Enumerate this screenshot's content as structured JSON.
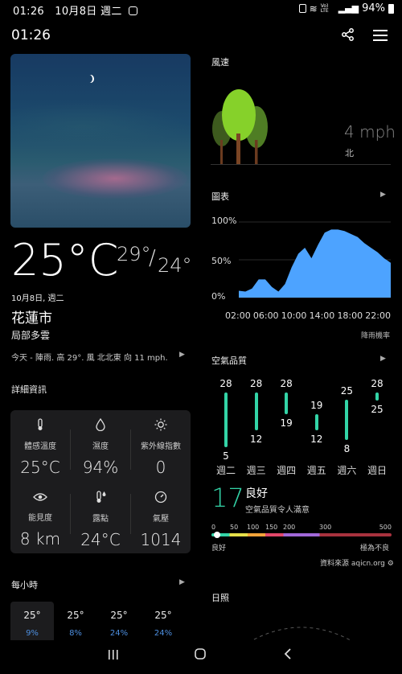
{
  "status_bar": {
    "time": "01:26",
    "date": "10月8日 週二",
    "battery": "94%",
    "volte": "Vo) LTE"
  },
  "header": {
    "time": "01:26"
  },
  "current": {
    "temp": "25°C",
    "high": "29°",
    "sep": "/",
    "low": "24°",
    "date": "10月8日, 週二",
    "city": "花蓮市",
    "condition": "局部多雲",
    "summary": "今天 - 陣雨. 高 29°. 風 北北東 向 11 mph."
  },
  "details": {
    "title": "詳細資訊",
    "cells": [
      {
        "label": "體感溫度",
        "value": "25°C",
        "icon": "thermometer-icon"
      },
      {
        "label": "濕度",
        "value": "94%",
        "icon": "droplet-icon"
      },
      {
        "label": "紫外線指數",
        "value": "0",
        "icon": "sun-icon"
      },
      {
        "label": "能見度",
        "value": "8 km",
        "icon": "eye-icon"
      },
      {
        "label": "露點",
        "value": "24°C",
        "icon": "dewpoint-icon"
      },
      {
        "label": "氣壓",
        "value": "1014",
        "icon": "gauge-icon"
      }
    ]
  },
  "hourly": {
    "title": "每小時",
    "items": [
      {
        "temp": "25°",
        "precip": "9%"
      },
      {
        "temp": "25°",
        "precip": "8%"
      },
      {
        "temp": "25°",
        "precip": "24%"
      },
      {
        "temp": "25°",
        "precip": "24%"
      }
    ]
  },
  "wind": {
    "title": "風速",
    "speed": "4 mph",
    "direction": "北"
  },
  "chart": {
    "title": "圖表",
    "footer": "降雨機率",
    "y_ticks": [
      "100%",
      "50%",
      "0%"
    ],
    "x_ticks": [
      "02:00",
      "06:00",
      "10:00",
      "14:00",
      "18:00",
      "22:00"
    ]
  },
  "chart_data": {
    "type": "area",
    "title": "圖表",
    "xlabel": "",
    "ylabel": "降雨機率",
    "ylim": [
      0,
      100
    ],
    "x": [
      "01:00",
      "02:00",
      "03:00",
      "04:00",
      "05:00",
      "06:00",
      "07:00",
      "08:00",
      "09:00",
      "10:00",
      "11:00",
      "12:00",
      "13:00",
      "14:00",
      "15:00",
      "16:00",
      "17:00",
      "18:00",
      "19:00",
      "20:00",
      "21:00",
      "22:00",
      "23:00",
      "24:00"
    ],
    "series": [
      {
        "values": [
          9,
          8,
          12,
          24,
          24,
          14,
          8,
          18,
          40,
          58,
          66,
          52,
          70,
          86,
          90,
          90,
          88,
          84,
          80,
          72,
          66,
          60,
          52,
          46
        ]
      }
    ],
    "grid": true,
    "color": "#4da3ff"
  },
  "aqi": {
    "title": "空氣品質",
    "days": [
      "週二",
      "週三",
      "週四",
      "週五",
      "週六",
      "週日"
    ],
    "highs": [
      "28",
      "28",
      "28",
      "19",
      "25",
      "28"
    ],
    "lows": [
      "5",
      "12",
      "19",
      "12",
      "8",
      "25"
    ],
    "value": "17",
    "level": "良好",
    "desc": "空氣品質令人滿意",
    "scale_labels": [
      "0",
      "50",
      "100",
      "150",
      "200",
      "300",
      "500"
    ],
    "left_label": "良好",
    "right_label": "極為不良",
    "source": "資料來源 aqicn.org",
    "color": "#33d4a7"
  },
  "sun": {
    "title": "日照"
  }
}
